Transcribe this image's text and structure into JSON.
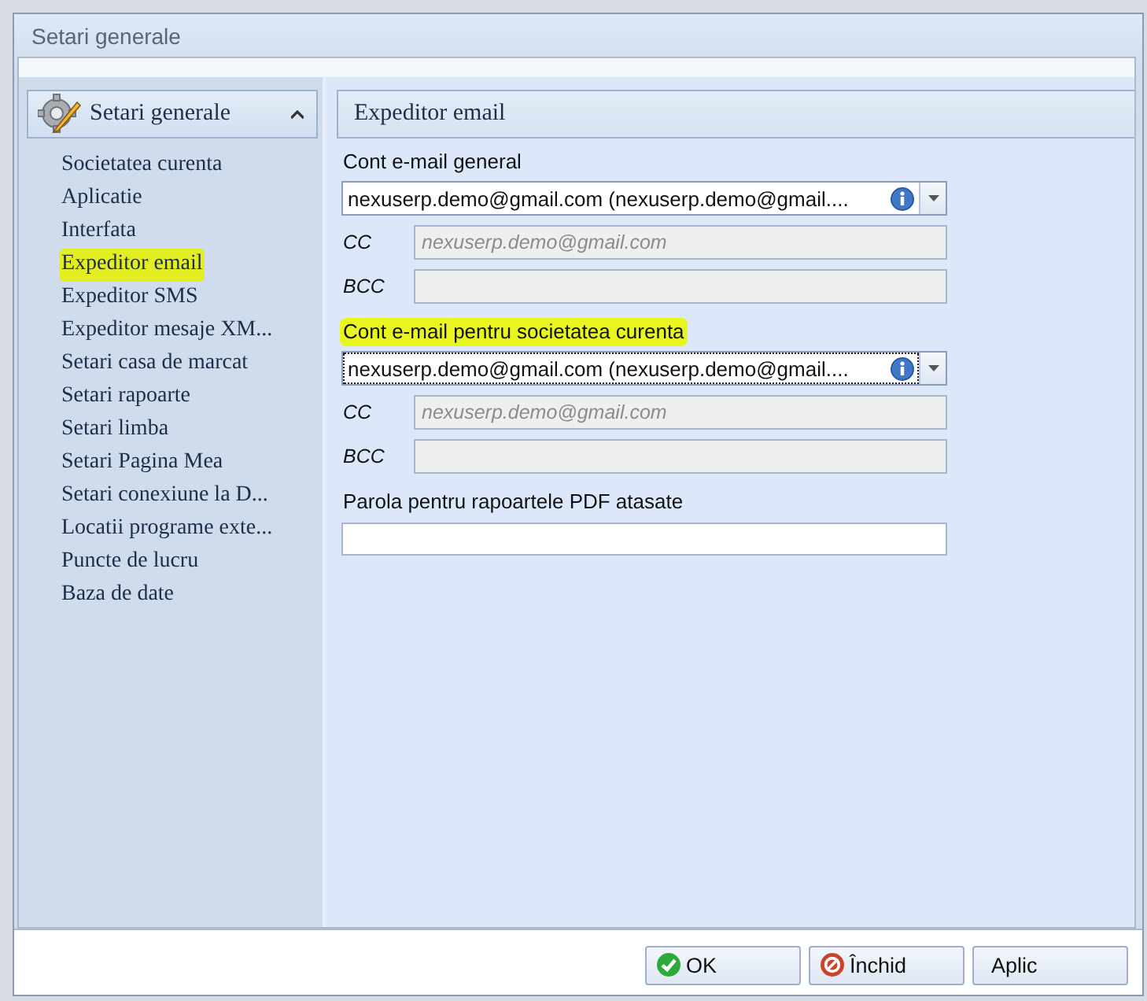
{
  "window": {
    "title": "Setari generale"
  },
  "sidebar": {
    "header": "Setari generale",
    "expanded": true,
    "items": [
      {
        "label": "Societatea curenta",
        "selected": false
      },
      {
        "label": "Aplicatie",
        "selected": false
      },
      {
        "label": "Interfata",
        "selected": false
      },
      {
        "label": "Expeditor email",
        "selected": true
      },
      {
        "label": "Expeditor SMS",
        "selected": false
      },
      {
        "label": "Expeditor mesaje XM...",
        "selected": false
      },
      {
        "label": "Setari casa de marcat",
        "selected": false
      },
      {
        "label": "Setari rapoarte",
        "selected": false
      },
      {
        "label": "Setari limba",
        "selected": false
      },
      {
        "label": "Setari Pagina Mea",
        "selected": false
      },
      {
        "label": "Setari conexiune la D...",
        "selected": false
      },
      {
        "label": "Locatii programe exte...",
        "selected": false
      },
      {
        "label": "Puncte de lucru",
        "selected": false
      },
      {
        "label": "Baza de date",
        "selected": false
      }
    ]
  },
  "panel": {
    "title": "Expeditor email",
    "sections": [
      {
        "label": "Cont e-mail general",
        "highlighted": false,
        "account": {
          "value": "nexuserp.demo@gmail.com (nexuserp.demo@gmail....",
          "focused": false
        },
        "cc": {
          "label": "CC",
          "placeholder": "nexuserp.demo@gmail.com"
        },
        "bcc": {
          "label": "BCC"
        }
      },
      {
        "label": "Cont e-mail pentru societatea curenta",
        "highlighted": true,
        "account": {
          "value": "nexuserp.demo@gmail.com (nexuserp.demo@gmail....",
          "focused": true
        },
        "cc": {
          "label": "CC",
          "placeholder": "nexuserp.demo@gmail.com"
        },
        "bcc": {
          "label": "BCC"
        }
      }
    ],
    "password": {
      "label": "Parola pentru rapoartele PDF atasate"
    }
  },
  "buttons": [
    {
      "label": "OK",
      "kind": "ok"
    },
    {
      "label": "Închid",
      "kind": "close"
    },
    {
      "label": "Aplic",
      "kind": "plain"
    }
  ]
}
